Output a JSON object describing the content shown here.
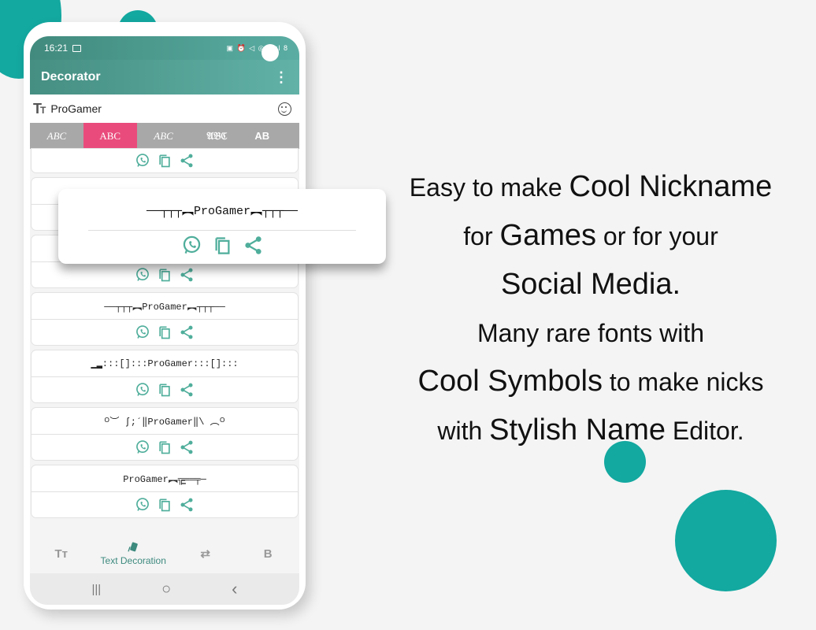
{
  "colors": {
    "accent": "#13a8a0",
    "appbar": "#4d998d",
    "active_tab": "#e94c7c",
    "icon": "#4fae9b"
  },
  "status_bar": {
    "time": "16:21",
    "indicators": "▣ ⏰ ◁ ◎ ıl ıl 8"
  },
  "app_bar": {
    "title": "Decorator",
    "menu_icon": "more-vert-icon"
  },
  "input": {
    "value": "ProGamer",
    "left_icon": "text-size-icon",
    "right_icon": "emoji-icon"
  },
  "font_tabs": [
    {
      "label": "ABC",
      "style": "script"
    },
    {
      "label": "ABC",
      "style": "serif",
      "active": true
    },
    {
      "label": "ABC",
      "style": "script"
    },
    {
      "label": "𝔄𝔅ℭ",
      "style": "gothic"
    },
    {
      "label": "AB",
      "style": "plain"
    }
  ],
  "list": {
    "items": [
      {
        "text": ""
      },
      {
        "text": ""
      },
      {
        "text": ""
      },
      {
        "text": "──┬┬┬︻ProGamer︻┬┬┬──"
      },
      {
        "text": "▁▂:::[]:::ProGamer:::[]:::"
      },
      {
        "text": "ᴼ︶ ʃ;´‖ProGamer‖\\ ︵ᴼ"
      },
      {
        "text": "ProGamer︻╦̵̵͇══╤─"
      }
    ],
    "action_icons": [
      "whatsapp-icon",
      "copy-icon",
      "share-icon"
    ]
  },
  "popup": {
    "text": "──┬┬┬︻ProGamer︻┬┬┬──"
  },
  "bottom_nav": [
    {
      "label": "Tт",
      "icon": "text-size-icon"
    },
    {
      "label": "Text Decoration",
      "icon": "decoration-icon",
      "active": true
    },
    {
      "label": "⇄",
      "icon": "swap-icon"
    },
    {
      "label": "B",
      "icon": "bold-icon"
    }
  ],
  "system_nav": {
    "recent": "|||",
    "home": "○",
    "back": "‹"
  },
  "promo": {
    "line1_a": "Easy to make ",
    "line1_b": "Cool Nickname",
    "line2_a": "for ",
    "line2_b": "Games",
    "line2_c": " or for your",
    "line3": "Social Media.",
    "line4": "Many rare fonts with",
    "line5_a": "Cool Symbols",
    "line5_b": " to make nicks",
    "line6_a": "with ",
    "line6_b": "Stylish Name",
    "line6_c": " Editor."
  }
}
